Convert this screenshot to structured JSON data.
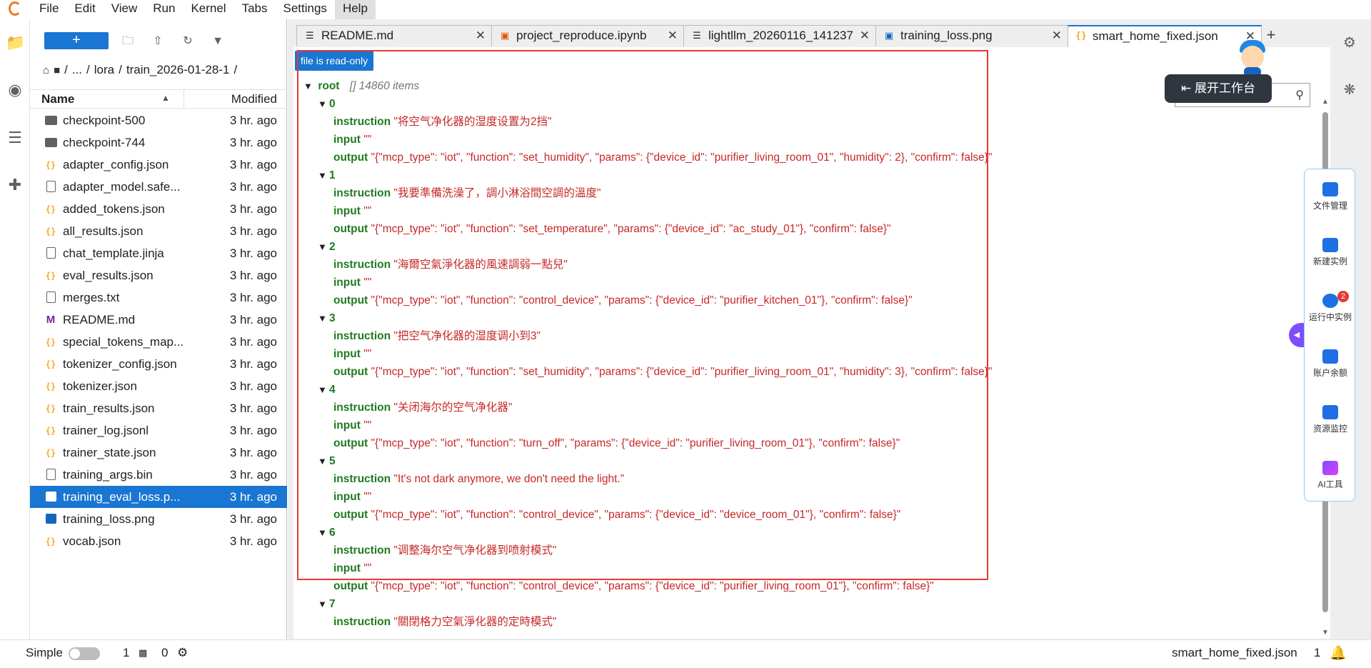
{
  "menubar": {
    "items": [
      "File",
      "Edit",
      "View",
      "Run",
      "Kernel",
      "Tabs",
      "Settings",
      "Help"
    ],
    "active": "Help"
  },
  "activity_icons": [
    "folder-icon",
    "running-icon",
    "toc-icon",
    "extension-icon"
  ],
  "filebrowser": {
    "new_label": "+",
    "breadcrumb": [
      "/",
      "...",
      "/",
      "lora",
      "/",
      "train_2026-01-28-1",
      "/"
    ],
    "header": {
      "name": "Name",
      "modified": "Modified"
    },
    "files": [
      {
        "name": "checkpoint-500",
        "type": "folder",
        "modified": "3 hr. ago"
      },
      {
        "name": "checkpoint-744",
        "type": "folder",
        "modified": "3 hr. ago"
      },
      {
        "name": "adapter_config.json",
        "type": "json",
        "modified": "3 hr. ago"
      },
      {
        "name": "adapter_model.safe...",
        "type": "file",
        "modified": "3 hr. ago"
      },
      {
        "name": "added_tokens.json",
        "type": "json",
        "modified": "3 hr. ago"
      },
      {
        "name": "all_results.json",
        "type": "json",
        "modified": "3 hr. ago"
      },
      {
        "name": "chat_template.jinja",
        "type": "file",
        "modified": "3 hr. ago"
      },
      {
        "name": "eval_results.json",
        "type": "json",
        "modified": "3 hr. ago"
      },
      {
        "name": "merges.txt",
        "type": "file",
        "modified": "3 hr. ago"
      },
      {
        "name": "README.md",
        "type": "md",
        "modified": "3 hr. ago"
      },
      {
        "name": "special_tokens_map...",
        "type": "json",
        "modified": "3 hr. ago"
      },
      {
        "name": "tokenizer_config.json",
        "type": "json",
        "modified": "3 hr. ago"
      },
      {
        "name": "tokenizer.json",
        "type": "json",
        "modified": "3 hr. ago"
      },
      {
        "name": "train_results.json",
        "type": "json",
        "modified": "3 hr. ago"
      },
      {
        "name": "trainer_log.jsonl",
        "type": "json",
        "modified": "3 hr. ago"
      },
      {
        "name": "trainer_state.json",
        "type": "json",
        "modified": "3 hr. ago"
      },
      {
        "name": "training_args.bin",
        "type": "file",
        "modified": "3 hr. ago"
      },
      {
        "name": "training_eval_loss.p...",
        "type": "image",
        "modified": "3 hr. ago",
        "selected": true
      },
      {
        "name": "training_loss.png",
        "type": "image",
        "modified": "3 hr. ago"
      },
      {
        "name": "vocab.json",
        "type": "json",
        "modified": "3 hr. ago"
      }
    ]
  },
  "tabs": [
    {
      "label": "README.md",
      "icon": "markdown-icon"
    },
    {
      "label": "project_reproduce.ipynb",
      "icon": "notebook-icon"
    },
    {
      "label": "lightllm_20260116_141237",
      "icon": "text-icon"
    },
    {
      "label": "training_loss.png",
      "icon": "image-icon"
    },
    {
      "label": "smart_home_fixed.json",
      "icon": "json-icon",
      "active": true
    }
  ],
  "readonly_badge": "file is read-only",
  "json_viewer": {
    "root_label": "root",
    "root_meta": "[]  14860 items",
    "records": [
      {
        "idx": "0",
        "instruction": "\"将空气净化器的湿度设置为2挡\"",
        "input": "\"\"",
        "output": "\"{\"mcp_type\": \"iot\", \"function\": \"set_humidity\", \"params\": {\"device_id\": \"purifier_living_room_01\", \"humidity\": 2}, \"confirm\": false}\""
      },
      {
        "idx": "1",
        "instruction": "\"我要準備洗澡了，調小淋浴間空調的溫度\"",
        "input": "\"\"",
        "output": "\"{\"mcp_type\": \"iot\", \"function\": \"set_temperature\", \"params\": {\"device_id\": \"ac_study_01\"}, \"confirm\": false}\""
      },
      {
        "idx": "2",
        "instruction": "\"海爾空氣淨化器的風速調弱一點兒\"",
        "input": "\"\"",
        "output": "\"{\"mcp_type\": \"iot\", \"function\": \"control_device\", \"params\": {\"device_id\": \"purifier_kitchen_01\"}, \"confirm\": false}\""
      },
      {
        "idx": "3",
        "instruction": "\"把空气净化器的湿度调小到3\"",
        "input": "\"\"",
        "output": "\"{\"mcp_type\": \"iot\", \"function\": \"set_humidity\", \"params\": {\"device_id\": \"purifier_living_room_01\", \"humidity\": 3}, \"confirm\": false}\""
      },
      {
        "idx": "4",
        "instruction": "\"关闭海尔的空气净化器\"",
        "input": "\"\"",
        "output": "\"{\"mcp_type\": \"iot\", \"function\": \"turn_off\", \"params\": {\"device_id\": \"purifier_living_room_01\"}, \"confirm\": false}\""
      },
      {
        "idx": "5",
        "instruction": "\"It's not dark anymore, we don't need the light.\"",
        "input": "\"\"",
        "output": "\"{\"mcp_type\": \"iot\", \"function\": \"control_device\", \"params\": {\"device_id\": \"device_room_01\"}, \"confirm\": false}\""
      },
      {
        "idx": "6",
        "instruction": "\"调整海尔空气净化器到喷射模式\"",
        "input": "\"\"",
        "output": "\"{\"mcp_type\": \"iot\", \"function\": \"control_device\", \"params\": {\"device_id\": \"purifier_living_room_01\"}, \"confirm\": false}\""
      },
      {
        "idx": "7",
        "instruction": "\"關閉格力空氣淨化器的定時模式\"",
        "input": null,
        "output": null
      }
    ],
    "keys": {
      "instruction": "instruction",
      "input": "input",
      "output": "output"
    }
  },
  "overlay": {
    "expand_label": "⇤ 展开工作台",
    "side_items": [
      {
        "label": "文件管理",
        "icon": "folder-manage-icon"
      },
      {
        "label": "新建实例",
        "icon": "new-instance-icon"
      },
      {
        "label": "运行中实例",
        "icon": "running-instance-icon",
        "badge": "2"
      },
      {
        "label": "账户余额",
        "icon": "balance-icon"
      },
      {
        "label": "资源监控",
        "icon": "monitor-icon"
      },
      {
        "label": "AI工具",
        "icon": "ai-tools-icon"
      }
    ]
  },
  "statusbar": {
    "mode_label": "Simple",
    "terminals": "1",
    "kernels": "0",
    "filename": "smart_home_fixed.json",
    "line": "1"
  }
}
